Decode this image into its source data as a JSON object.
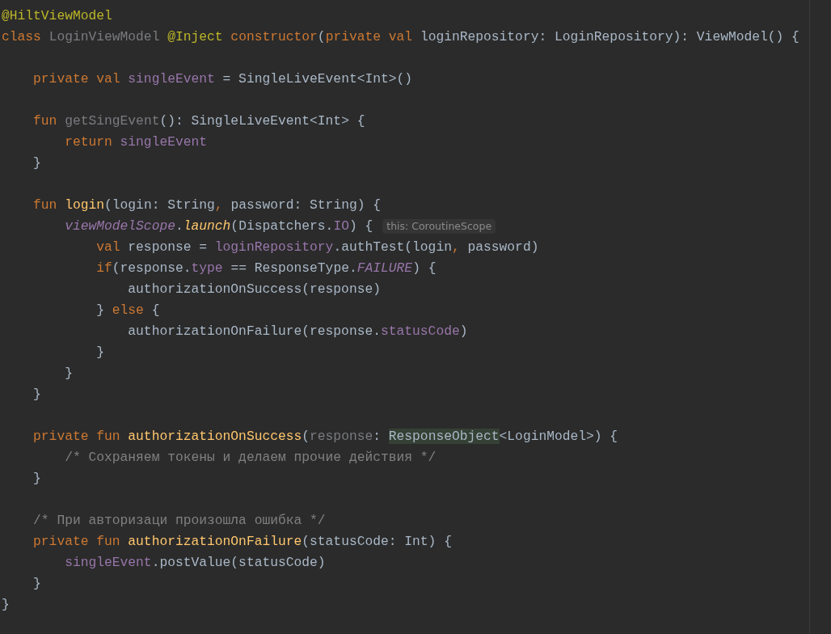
{
  "editor": {
    "blocks": [
      {
        "lines": [
          {
            "tokens": [
              {
                "kind": "annotation",
                "text": "@HiltViewModel"
              }
            ]
          },
          {
            "tokens": [
              {
                "kind": "keyword",
                "text": "class "
              },
              {
                "kind": "unused",
                "text": "LoginViewModel "
              },
              {
                "kind": "annotation",
                "text": "@Inject "
              },
              {
                "kind": "keyword",
                "text": "constructor"
              },
              {
                "kind": "plain",
                "text": "("
              },
              {
                "kind": "keyword",
                "text": "private val "
              },
              {
                "kind": "plain",
                "text": "loginRepository: LoginRepository): ViewModel() {"
              }
            ]
          }
        ]
      },
      {
        "lines": [
          {
            "tokens": [
              {
                "kind": "keyword",
                "text": "    private val "
              },
              {
                "kind": "property",
                "text": "singleEvent"
              },
              {
                "kind": "plain",
                "text": " = SingleLiveEvent<Int>()"
              }
            ]
          }
        ]
      },
      {
        "lines": [
          {
            "tokens": [
              {
                "kind": "keyword",
                "text": "    fun "
              },
              {
                "kind": "unused",
                "text": "getSingEvent"
              },
              {
                "kind": "plain",
                "text": "(): SingleLiveEvent<Int> {"
              }
            ]
          },
          {
            "tokens": [
              {
                "kind": "keyword",
                "text": "        return "
              },
              {
                "kind": "property",
                "text": "singleEvent"
              }
            ]
          },
          {
            "tokens": [
              {
                "kind": "plain",
                "text": "    }"
              }
            ]
          }
        ]
      },
      {
        "lines": [
          {
            "tokens": [
              {
                "kind": "keyword",
                "text": "    fun "
              },
              {
                "kind": "function",
                "text": "login"
              },
              {
                "kind": "plain",
                "text": "(login: String"
              },
              {
                "kind": "keyword",
                "text": ", "
              },
              {
                "kind": "plain",
                "text": "password: String) {"
              }
            ]
          },
          {
            "tokens": [
              {
                "kind": "property-italic",
                "text": "        viewModelScope"
              },
              {
                "kind": "plain",
                "text": "."
              },
              {
                "kind": "function-italic",
                "text": "launch"
              },
              {
                "kind": "plain",
                "text": "(Dispatchers."
              },
              {
                "kind": "property",
                "text": "IO"
              },
              {
                "kind": "plain",
                "text": ") {"
              }
            ],
            "hint": "this: CoroutineScope"
          },
          {
            "tokens": [
              {
                "kind": "keyword",
                "text": "            val "
              },
              {
                "kind": "plain",
                "text": "response = "
              },
              {
                "kind": "property",
                "text": "loginRepository"
              },
              {
                "kind": "plain",
                "text": ".authTest(login"
              },
              {
                "kind": "keyword",
                "text": ", "
              },
              {
                "kind": "plain",
                "text": "password)"
              }
            ]
          },
          {
            "tokens": [
              {
                "kind": "keyword",
                "text": "            if"
              },
              {
                "kind": "plain",
                "text": "(response."
              },
              {
                "kind": "property",
                "text": "type"
              },
              {
                "kind": "plain",
                "text": " == ResponseType."
              },
              {
                "kind": "property-italic",
                "text": "FAILURE"
              },
              {
                "kind": "plain",
                "text": ") {"
              }
            ]
          },
          {
            "tokens": [
              {
                "kind": "plain",
                "text": "                authorizationOnSuccess(response)"
              }
            ]
          },
          {
            "tokens": [
              {
                "kind": "plain",
                "text": "            } "
              },
              {
                "kind": "keyword",
                "text": "else "
              },
              {
                "kind": "plain",
                "text": "{"
              }
            ]
          },
          {
            "tokens": [
              {
                "kind": "plain",
                "text": "                authorizationOnFailure(response."
              },
              {
                "kind": "property",
                "text": "statusCode"
              },
              {
                "kind": "plain",
                "text": ")"
              }
            ]
          },
          {
            "tokens": [
              {
                "kind": "plain",
                "text": "            }"
              }
            ]
          },
          {
            "tokens": [
              {
                "kind": "plain",
                "text": "        }"
              }
            ]
          },
          {
            "tokens": [
              {
                "kind": "plain",
                "text": "    }"
              }
            ]
          }
        ]
      },
      {
        "lines": [
          {
            "tokens": [
              {
                "kind": "keyword",
                "text": "    private fun "
              },
              {
                "kind": "function",
                "text": "authorizationOnSuccess"
              },
              {
                "kind": "plain",
                "text": "("
              },
              {
                "kind": "unused",
                "text": "response"
              },
              {
                "kind": "plain",
                "text": ": "
              },
              {
                "kind": "highlight",
                "text": "ResponseObject"
              },
              {
                "kind": "plain",
                "text": "<LoginModel>) {"
              }
            ]
          },
          {
            "tokens": [
              {
                "kind": "comment",
                "text": "        /* Сохраняем токены и делаем прочие действия */"
              }
            ]
          },
          {
            "tokens": [
              {
                "kind": "plain",
                "text": "    }"
              }
            ]
          }
        ]
      },
      {
        "lines": [
          {
            "tokens": [
              {
                "kind": "comment",
                "text": "    /* При авторизаци произошла ошибка */"
              }
            ]
          },
          {
            "tokens": [
              {
                "kind": "keyword",
                "text": "    private fun "
              },
              {
                "kind": "function",
                "text": "authorizationOnFailure"
              },
              {
                "kind": "plain",
                "text": "(statusCode: Int) {"
              }
            ]
          },
          {
            "tokens": [
              {
                "kind": "property",
                "text": "        singleEvent"
              },
              {
                "kind": "plain",
                "text": ".postValue(statusCode)"
              }
            ]
          },
          {
            "tokens": [
              {
                "kind": "plain",
                "text": "    }"
              }
            ]
          },
          {
            "tokens": [
              {
                "kind": "plain",
                "text": "}"
              }
            ]
          }
        ]
      }
    ]
  }
}
